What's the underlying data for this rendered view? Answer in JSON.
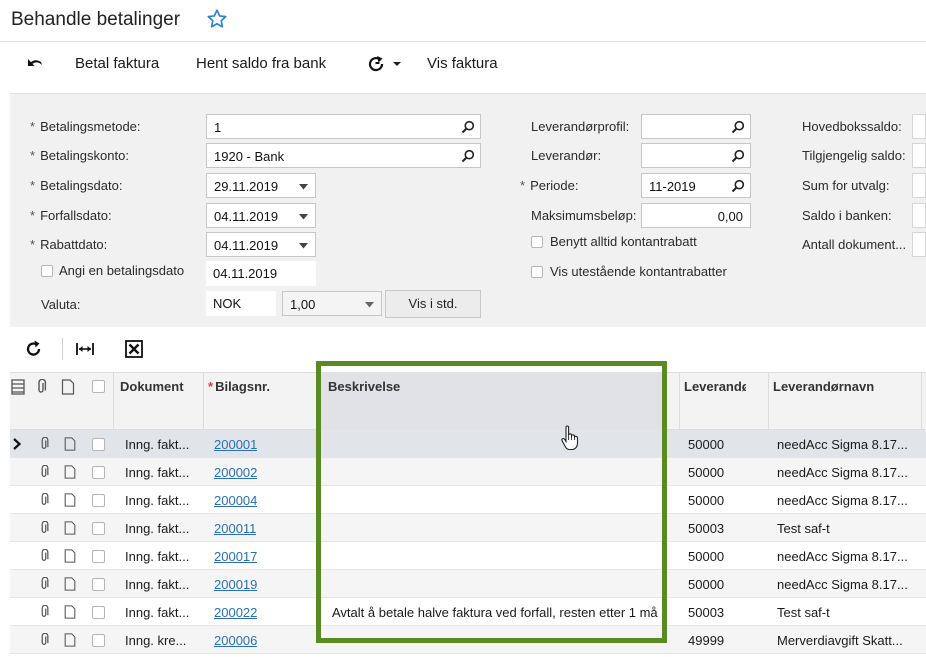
{
  "page": {
    "title": "Behandle betalinger"
  },
  "toolbar": {
    "pay_invoice": "Betal faktura",
    "fetch_balance": "Hent saldo fra bank",
    "show_invoice": "Vis faktura"
  },
  "form": {
    "payment_method": {
      "label": "Betalingsmetode:",
      "value": "1"
    },
    "payment_account": {
      "label": "Betalingskonto:",
      "value": "1920 - Bank"
    },
    "payment_date": {
      "label": "Betalingsdato:",
      "value": "29.11.2019"
    },
    "due_date": {
      "label": "Forfallsdato:",
      "value": "04.11.2019"
    },
    "discount_date": {
      "label": "Rabattdato:",
      "value": "04.11.2019"
    },
    "specify_payment_date": {
      "label": "Angi en betalingsdato",
      "value": "04.11.2019"
    },
    "currency": {
      "label": "Valuta:",
      "value": "NOK",
      "rate": "1,00",
      "button": "Vis i std."
    },
    "vendor_profile": {
      "label": "Leverandørprofil:",
      "value": ""
    },
    "vendor": {
      "label": "Leverandør:",
      "value": ""
    },
    "period": {
      "label": "Periode:",
      "value": "11-2019"
    },
    "max_amount": {
      "label": "Maksimumsbeløp:",
      "value": "0,00"
    },
    "always_cash_discount": {
      "label": "Benytt alltid kontantrabatt"
    },
    "show_outstanding_discounts": {
      "label": "Vis utestående kontantrabatter"
    },
    "summary": {
      "ledger_balance": "Hovedbokssaldo:",
      "available_balance": "Tilgjengelig saldo:",
      "sum_selection": "Sum for utvalg:",
      "bank_balance": "Saldo i banken:",
      "doc_count": "Antall dokument..."
    }
  },
  "grid": {
    "columns": {
      "document": "Dokument",
      "voucher": "Bilagsnr.",
      "description": "Beskrivelse",
      "vendor": "Leverandø",
      "vendor_name": "Leverandørnavn"
    },
    "rows": [
      {
        "doc": "Inng. fakt...",
        "voucher": "200001",
        "desc": "",
        "vendor": "50000",
        "name": "needAcc Sigma 8.17..."
      },
      {
        "doc": "Inng. fakt...",
        "voucher": "200002",
        "desc": "",
        "vendor": "50000",
        "name": "needAcc Sigma 8.17..."
      },
      {
        "doc": "Inng. fakt...",
        "voucher": "200004",
        "desc": "",
        "vendor": "50000",
        "name": "needAcc Sigma 8.17..."
      },
      {
        "doc": "Inng. fakt...",
        "voucher": "200011",
        "desc": "",
        "vendor": "50003",
        "name": "Test saf-t"
      },
      {
        "doc": "Inng. fakt...",
        "voucher": "200017",
        "desc": "",
        "vendor": "50000",
        "name": "needAcc Sigma 8.17..."
      },
      {
        "doc": "Inng. fakt...",
        "voucher": "200019",
        "desc": "",
        "vendor": "50000",
        "name": "needAcc Sigma 8.17..."
      },
      {
        "doc": "Inng. fakt...",
        "voucher": "200022",
        "desc": "Avtalt å betale halve faktura ved forfall, resten etter 1 må",
        "vendor": "50003",
        "name": "Test saf-t"
      },
      {
        "doc": "Inng. kre...",
        "voucher": "200006",
        "desc": "",
        "vendor": "49999",
        "name": "Merverdiavgift Skatt..."
      }
    ]
  },
  "colors": {
    "highlight": "#5a8a22",
    "link": "#2a6fb5"
  }
}
